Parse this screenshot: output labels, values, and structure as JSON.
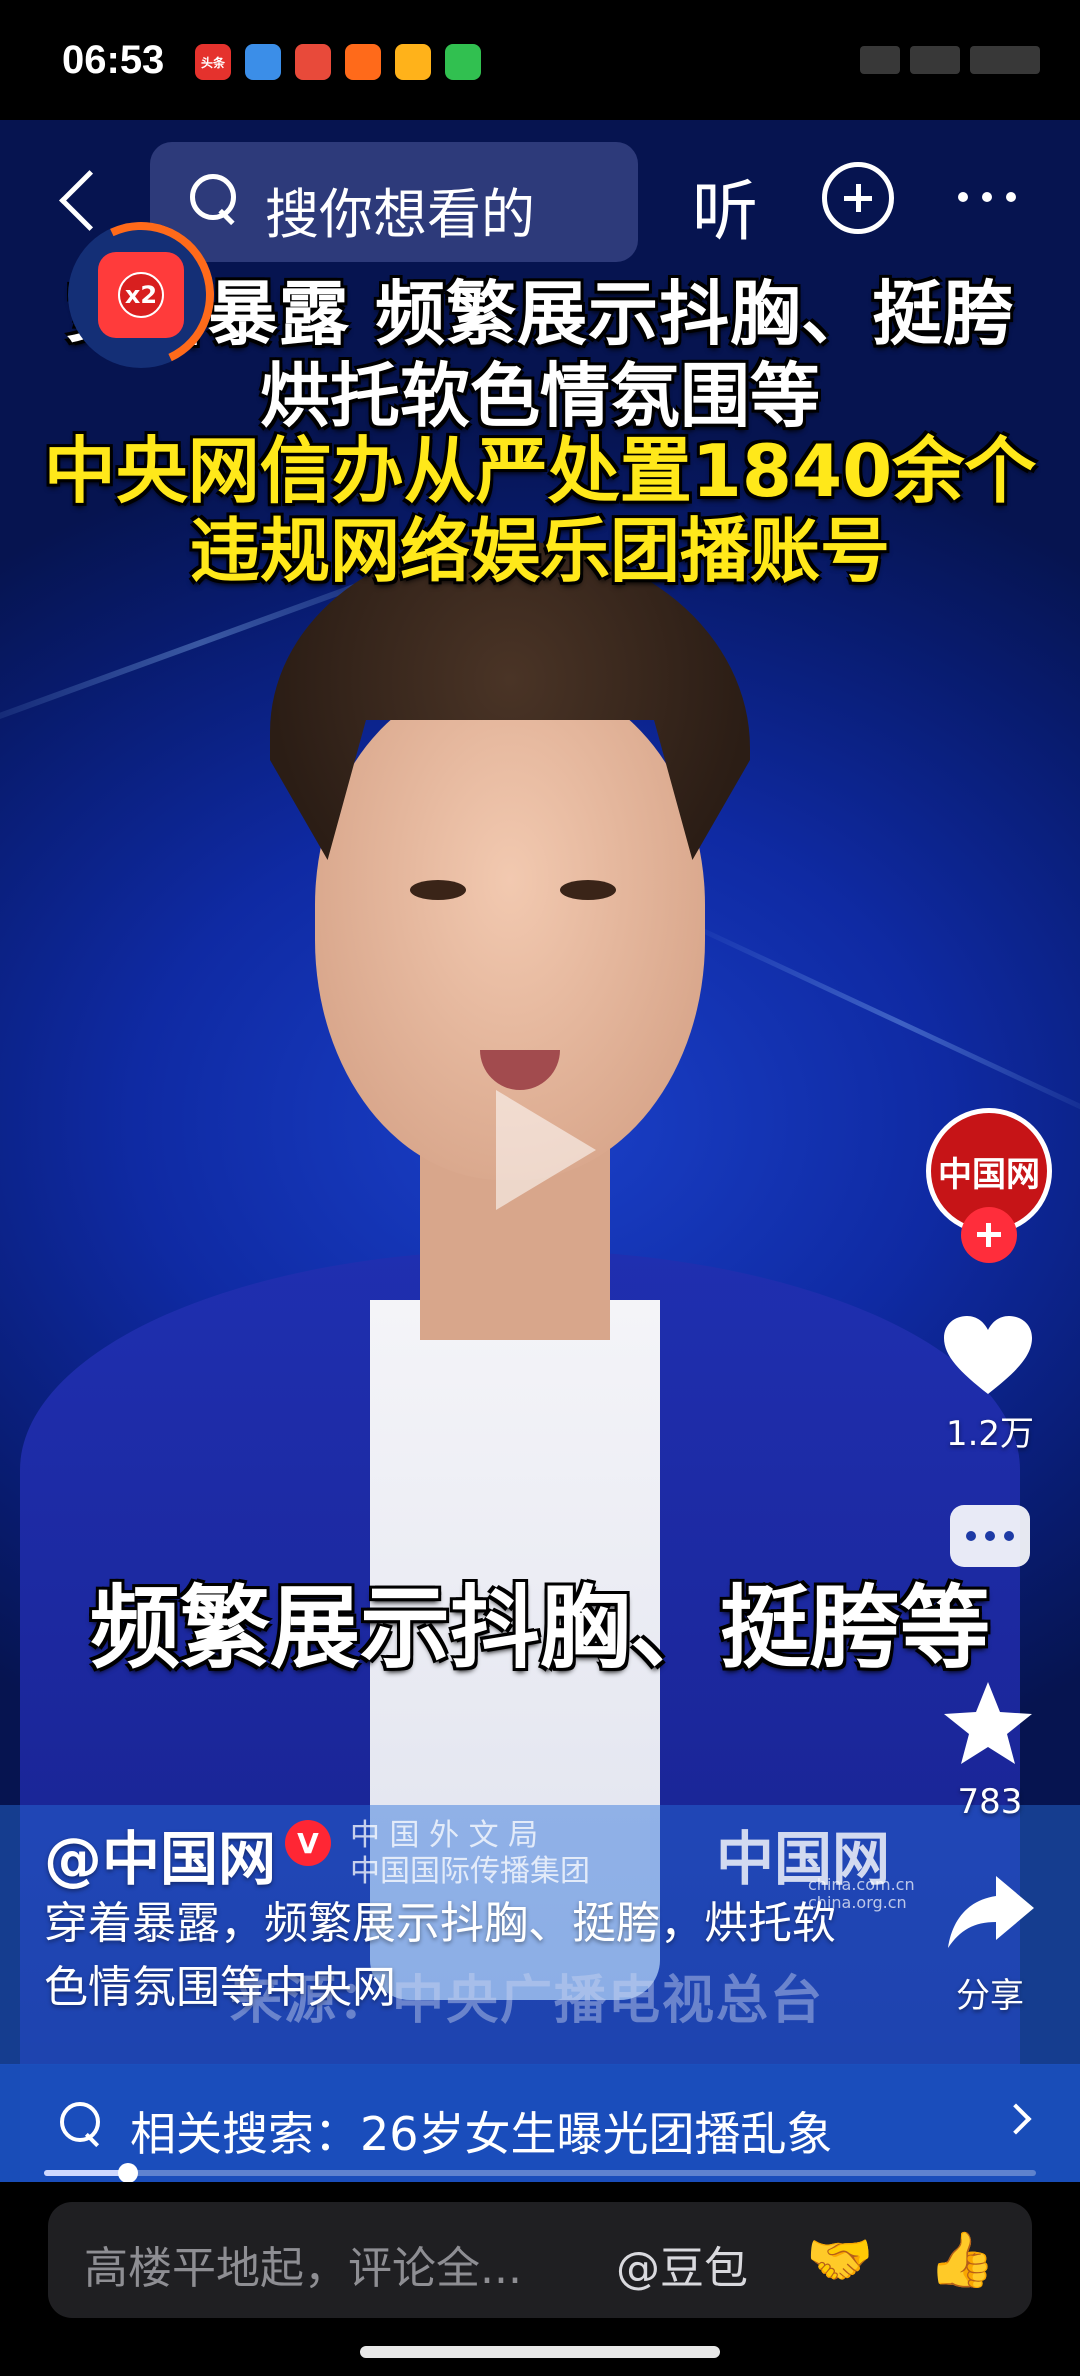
{
  "status_bar": {
    "time": "06:53",
    "app_icons": [
      {
        "name": "toutiao-app-icon",
        "label": "头条",
        "color": "#e5322d"
      },
      {
        "name": "weather-app-icon",
        "label": "",
        "color": "#3b8ee8"
      },
      {
        "name": "game-app-icon",
        "label": "",
        "color": "#e84a3a"
      },
      {
        "name": "shop-app-icon",
        "label": "",
        "color": "#ff6a1a"
      },
      {
        "name": "video-app-icon",
        "label": "",
        "color": "#ffb21a"
      },
      {
        "name": "message-app-icon",
        "label": "",
        "color": "#31c050"
      }
    ]
  },
  "top_nav": {
    "search_placeholder": "搜你想看的",
    "listen_label": "听"
  },
  "boost_badge": {
    "label": "x2"
  },
  "video": {
    "caption_line1": "穿着暴露 频繁展示抖胸、挺胯",
    "caption_line2": "烘托软色情氛围等",
    "caption_line3": "中央网信办从严处置1840余个",
    "caption_line4": "违规网络娱乐团播账号",
    "subtitle": "频繁展示抖胸、挺胯等",
    "watermark_line1": "中 国 外 文 局",
    "watermark_line2": "中国国际传播集团",
    "watermark_logo": "中国网",
    "watermark_sub1": "china.com.cn",
    "watermark_sub2": "china.org.cn",
    "source_watermark": "来源：中央广播电视总台"
  },
  "rail": {
    "avatar_label": "中国网",
    "likes": "1.2万",
    "favorites": "783",
    "share_label": "分享"
  },
  "post": {
    "author": "@中国网",
    "verified_badge": "V",
    "description": "穿着暴露，频繁展示抖胸、挺胯，烘托软色情氛围等中央网"
  },
  "related_search": {
    "label": "相关搜索：26岁女生曝光团播乱象"
  },
  "progress": {
    "played_fraction": 0.085
  },
  "comment_bar": {
    "placeholder": "高楼平地起，评论全...",
    "mention": "@豆包",
    "emoji_1": "🤝",
    "emoji_2": "👍"
  },
  "colors": {
    "caption_yellow": "#ffe81a",
    "background_blue": "#0f2aa3",
    "accent_red": "#ff2634"
  }
}
